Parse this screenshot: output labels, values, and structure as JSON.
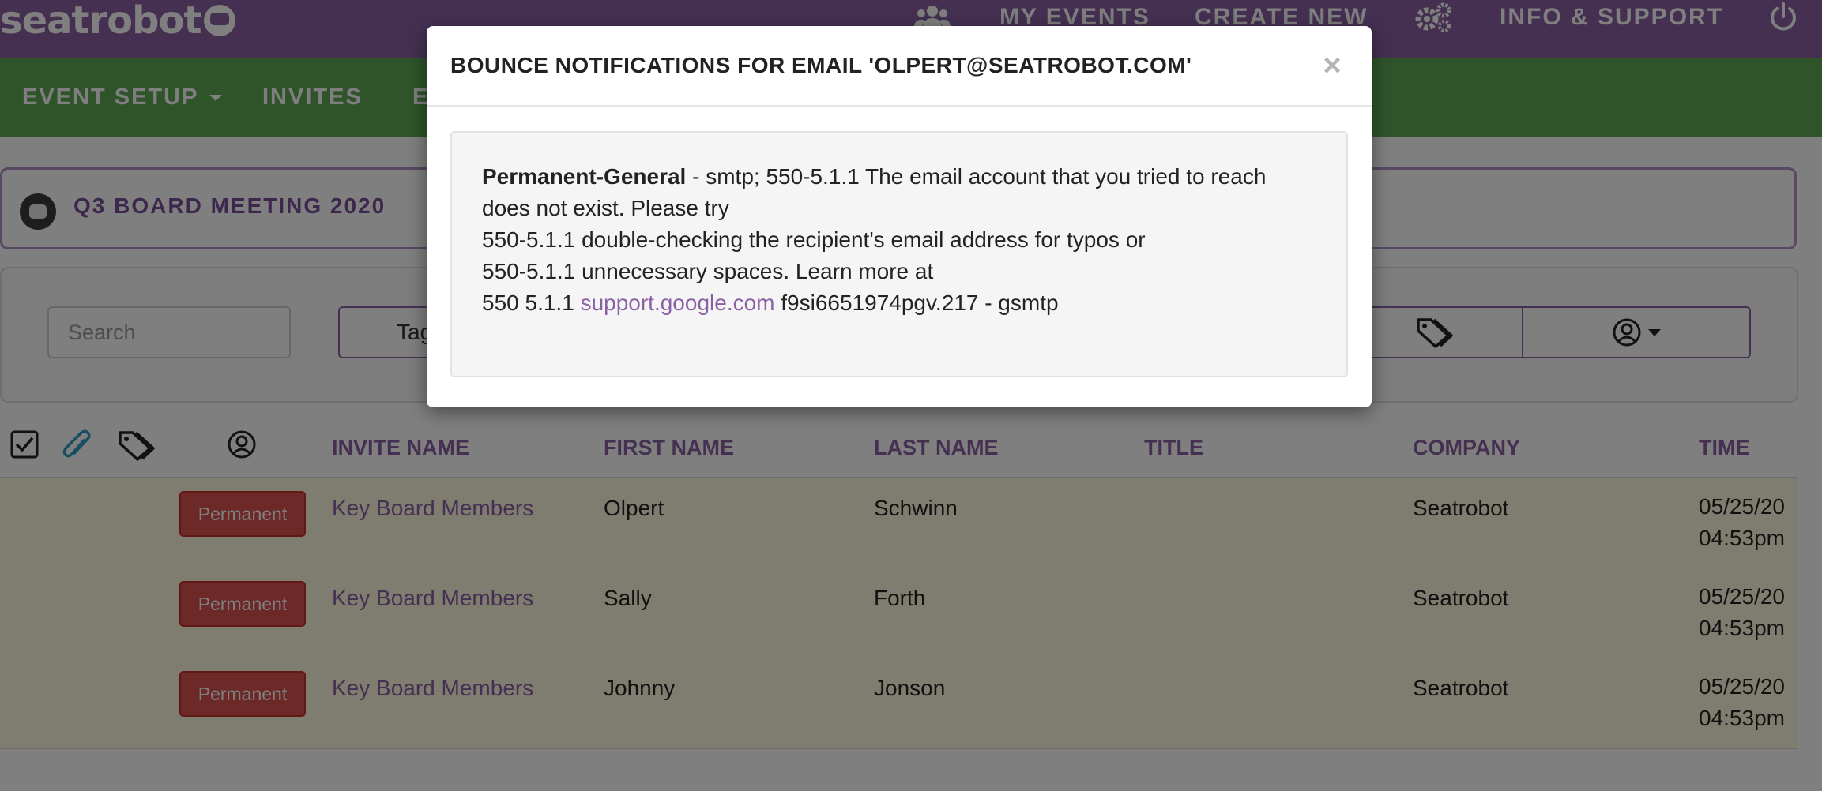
{
  "app": {
    "logo_text": "seatrobot",
    "nav": {
      "my_events": "MY EVENTS",
      "create_new": "CREATE NEW",
      "info_support": "INFO & SUPPORT"
    }
  },
  "subnav": {
    "event_setup": "EVENT SETUP",
    "invites": "INVITES",
    "partial": "E"
  },
  "event": {
    "title": "Q3 BOARD MEETING 2020"
  },
  "filters": {
    "search_placeholder": "Search",
    "tags_label": "Tag"
  },
  "table": {
    "headers": {
      "invite_name": "INVITE NAME",
      "first_name": "FIRST NAME",
      "last_name": "LAST NAME",
      "title": "TITLE",
      "company": "COMPANY",
      "time": "TIME"
    },
    "rows": [
      {
        "status": "Permanent",
        "invite_name": "Key Board Members",
        "first_name": "Olpert",
        "last_name": "Schwinn",
        "title": "",
        "company": "Seatrobot",
        "date": "05/25/20",
        "time": "04:53pm"
      },
      {
        "status": "Permanent",
        "invite_name": "Key Board Members",
        "first_name": "Sally",
        "last_name": "Forth",
        "title": "",
        "company": "Seatrobot",
        "date": "05/25/20",
        "time": "04:53pm"
      },
      {
        "status": "Permanent",
        "invite_name": "Key Board Members",
        "first_name": "Johnny",
        "last_name": "Jonson",
        "title": "",
        "company": "Seatrobot",
        "date": "05/25/20",
        "time": "04:53pm"
      }
    ]
  },
  "modal": {
    "title": "BOUNCE NOTIFICATIONS FOR EMAIL 'OLPERT@SEATROBOT.COM'",
    "close": "×",
    "bounce_type": "Permanent-General",
    "line1": " - smtp; 550-5.1.1 The email account that you tried to reach",
    "line2": "does not exist. Please try",
    "line3": "550-5.1.1 double-checking the recipient's email address for typos or",
    "line4": "550-5.1.1 unnecessary spaces. Learn more at",
    "line5_prefix": "550 5.1.1 ",
    "line5_link": "support.google.com",
    "line5_suffix": " f9si6651974pgv.217 - gsmtp"
  },
  "colors": {
    "brand_purple": "#8b61a4",
    "nav_green": "#5fa854",
    "danger_red": "#d9534f",
    "row_highlight": "#fff8e1"
  },
  "icons": {
    "top": [
      "users-icon",
      "gears-icon",
      "power-icon"
    ],
    "table_header": [
      "checkbox-checked-icon",
      "paperclip-icon",
      "tags-icon",
      "user-circle-icon"
    ],
    "filters": [
      "tags-icon",
      "user-circle-icon",
      "caret-down-icon"
    ]
  }
}
